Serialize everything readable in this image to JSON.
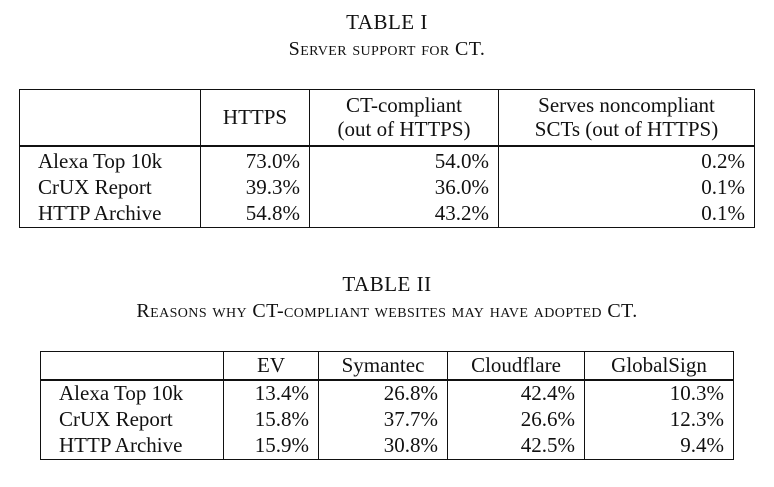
{
  "table1": {
    "label": "TABLE I",
    "title": "Server support for CT.",
    "headers": [
      "",
      "HTTPS",
      "CT-compliant",
      "(out of HTTPS)",
      "Serves noncompliant",
      "SCTs (out of HTTPS)"
    ],
    "rows": [
      [
        "Alexa Top 10k",
        "73.0%",
        "54.0%",
        "0.2%"
      ],
      [
        "CrUX Report",
        "39.3%",
        "36.0%",
        "0.1%"
      ],
      [
        "HTTP Archive",
        "54.8%",
        "43.2%",
        "0.1%"
      ]
    ]
  },
  "table2": {
    "label": "TABLE II",
    "title": "Reasons why CT-compliant websites may have adopted CT.",
    "headers": [
      "",
      "EV",
      "Symantec",
      "Cloudflare",
      "GlobalSign"
    ],
    "rows": [
      [
        "Alexa Top 10k",
        "13.4%",
        "26.8%",
        "42.4%",
        "10.3%"
      ],
      [
        "CrUX Report",
        "15.8%",
        "37.7%",
        "26.6%",
        "12.3%"
      ],
      [
        "HTTP Archive",
        "15.9%",
        "30.8%",
        "42.5%",
        "9.4%"
      ]
    ]
  }
}
